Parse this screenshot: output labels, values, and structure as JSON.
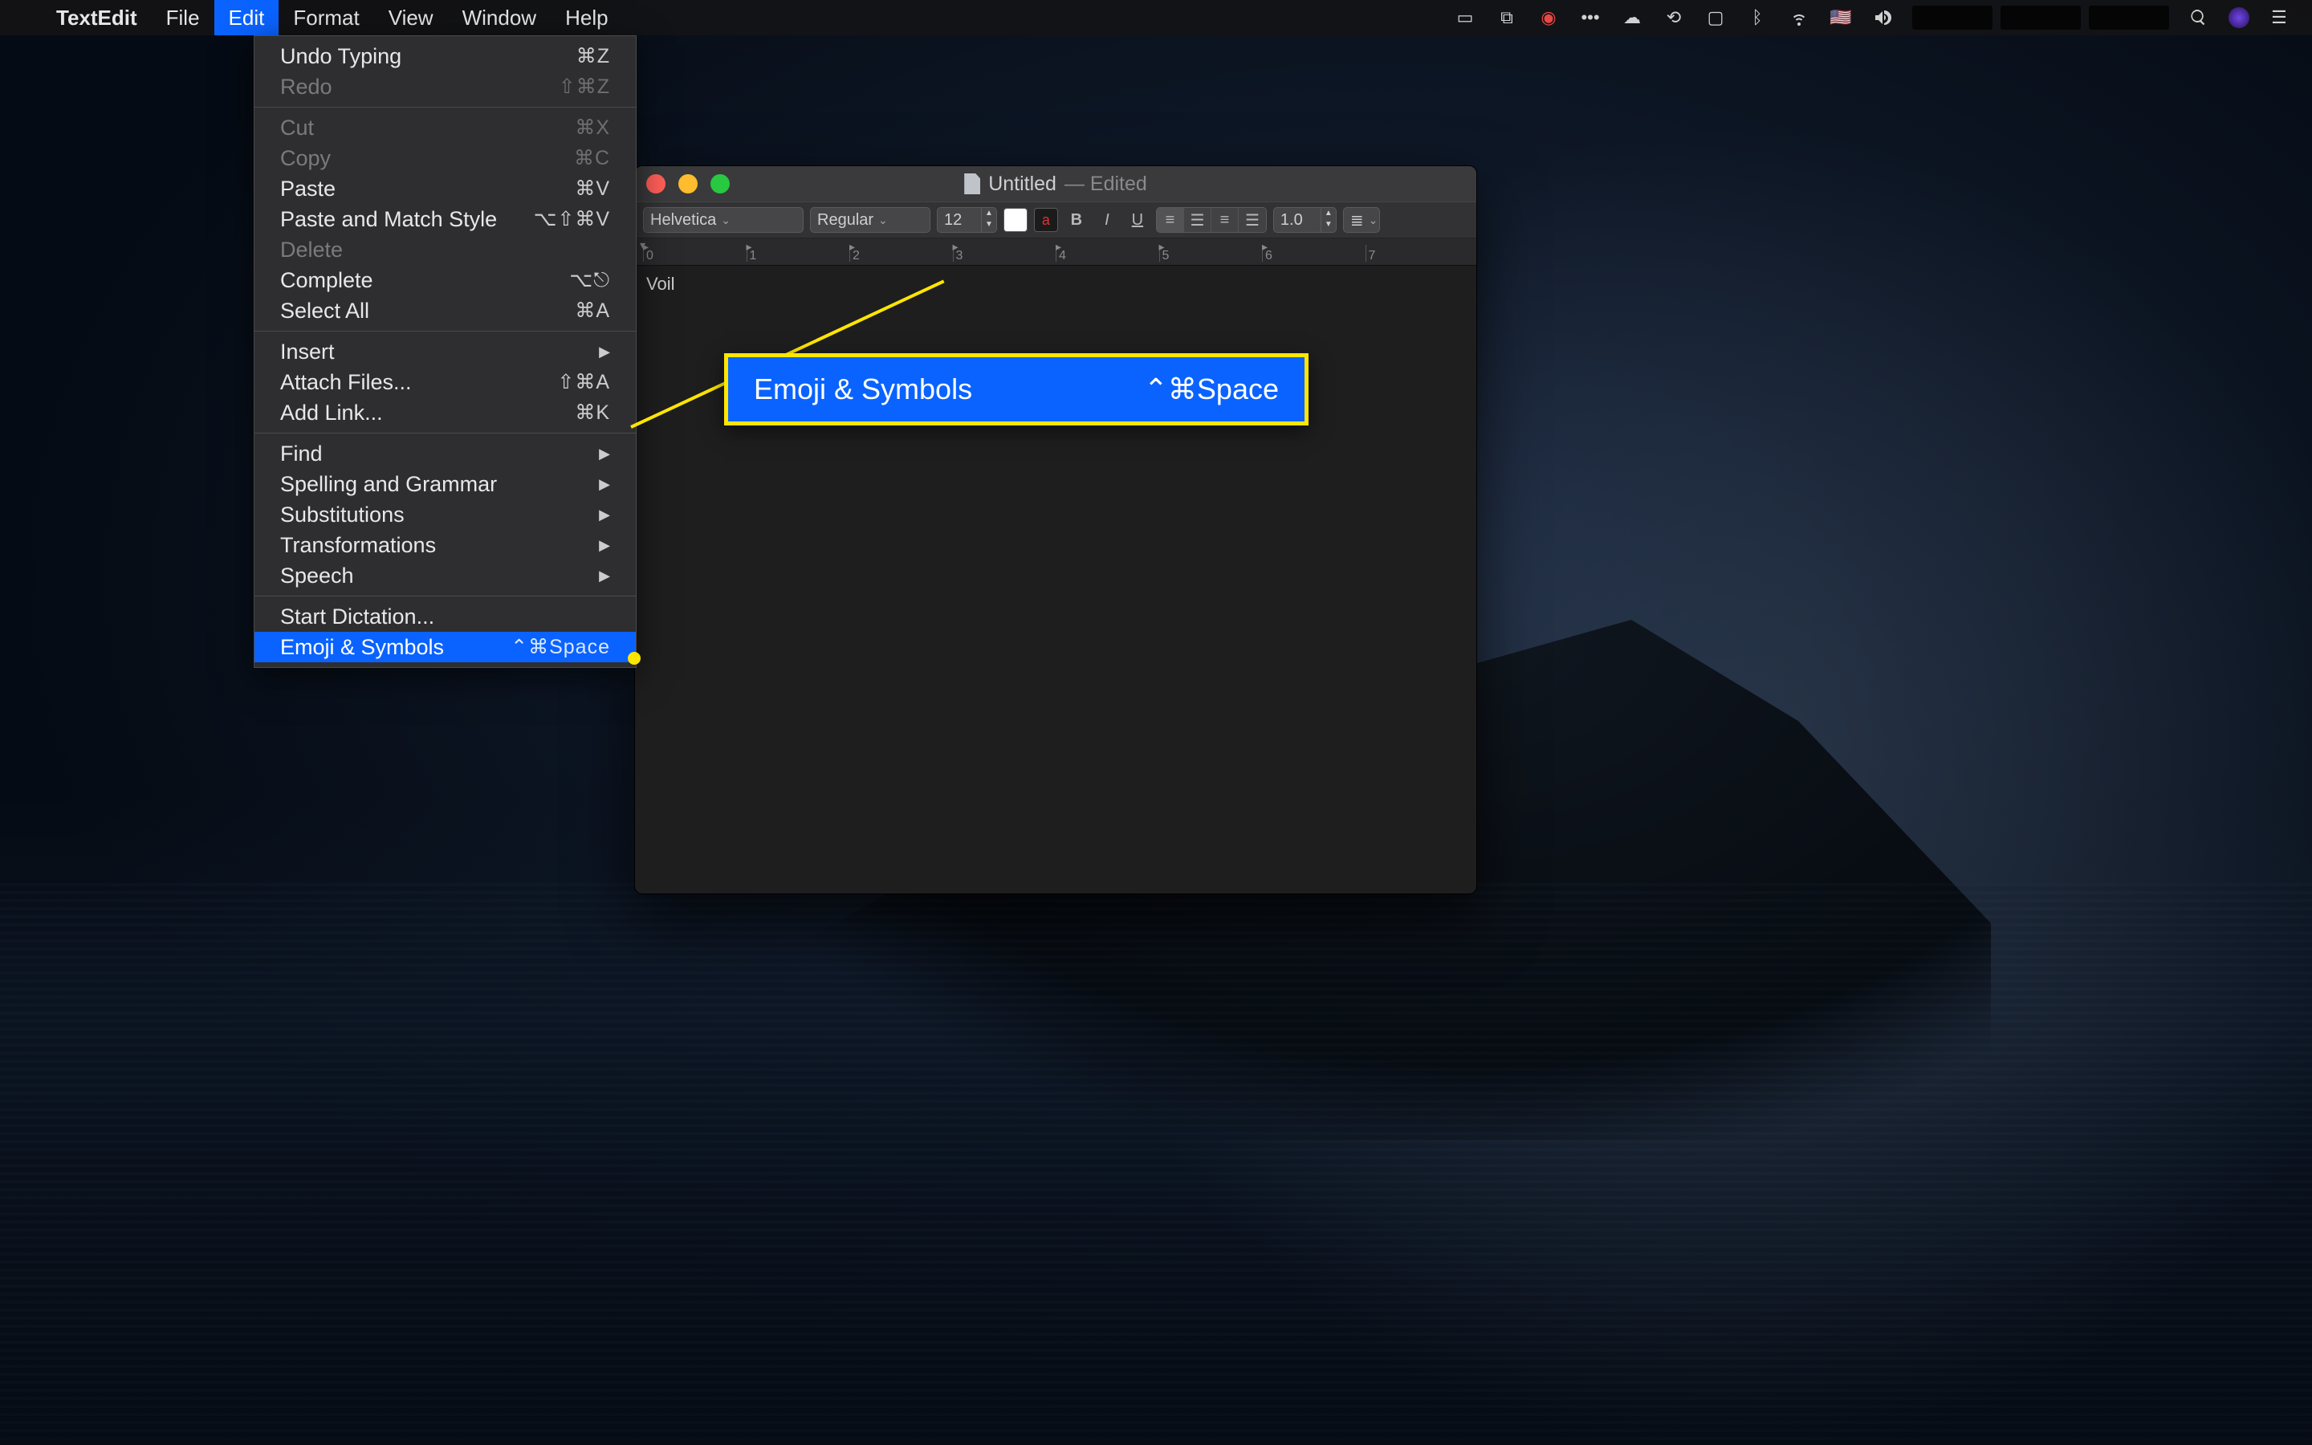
{
  "menubar": {
    "apple_icon": "",
    "app_name": "TextEdit",
    "items": [
      "File",
      "Edit",
      "Format",
      "View",
      "Window",
      "Help"
    ],
    "active_index": 1,
    "status_icons": [
      "display-icon",
      "dropbox-icon",
      "record-icon",
      "dots-icon",
      "cloud-icon",
      "timemachine-icon",
      "airplay-icon",
      "bluetooth-icon",
      "wifi-icon",
      "flag-us-icon",
      "volume-icon"
    ],
    "right_icons": [
      "spotlight-icon",
      "siri-icon",
      "notifications-icon"
    ]
  },
  "edit_menu": {
    "groups": [
      [
        {
          "label": "Undo Typing",
          "shortcut": "⌘Z",
          "disabled": false
        },
        {
          "label": "Redo",
          "shortcut": "⇧⌘Z",
          "disabled": true
        }
      ],
      [
        {
          "label": "Cut",
          "shortcut": "⌘X",
          "disabled": true
        },
        {
          "label": "Copy",
          "shortcut": "⌘C",
          "disabled": true
        },
        {
          "label": "Paste",
          "shortcut": "⌘V",
          "disabled": false
        },
        {
          "label": "Paste and Match Style",
          "shortcut": "⌥⇧⌘V",
          "disabled": false
        },
        {
          "label": "Delete",
          "shortcut": "",
          "disabled": true
        },
        {
          "label": "Complete",
          "shortcut": "⌥⎋",
          "disabled": false
        },
        {
          "label": "Select All",
          "shortcut": "⌘A",
          "disabled": false
        }
      ],
      [
        {
          "label": "Insert",
          "submenu": true
        },
        {
          "label": "Attach Files...",
          "shortcut": "⇧⌘A"
        },
        {
          "label": "Add Link...",
          "shortcut": "⌘K"
        }
      ],
      [
        {
          "label": "Find",
          "submenu": true
        },
        {
          "label": "Spelling and Grammar",
          "submenu": true
        },
        {
          "label": "Substitutions",
          "submenu": true
        },
        {
          "label": "Transformations",
          "submenu": true
        },
        {
          "label": "Speech",
          "submenu": true
        }
      ],
      [
        {
          "label": "Start Dictation...",
          "shortcut": ""
        },
        {
          "label": "Emoji & Symbols",
          "shortcut": "⌃⌘Space",
          "highlight": true
        }
      ]
    ]
  },
  "window": {
    "title": "Untitled",
    "subtitle": "— Edited",
    "toolbar": {
      "font_family": "Helvetica",
      "font_style": "Regular",
      "font_size": "12",
      "line_spacing": "1.0",
      "text_color_glyph": "a",
      "bold": "B",
      "italic": "I",
      "underline": "U"
    },
    "ruler": {
      "start": 0,
      "end": 7
    },
    "content_text": "Voil"
  },
  "callout": {
    "label": "Emoji & Symbols",
    "shortcut": "⌃⌘Space"
  }
}
